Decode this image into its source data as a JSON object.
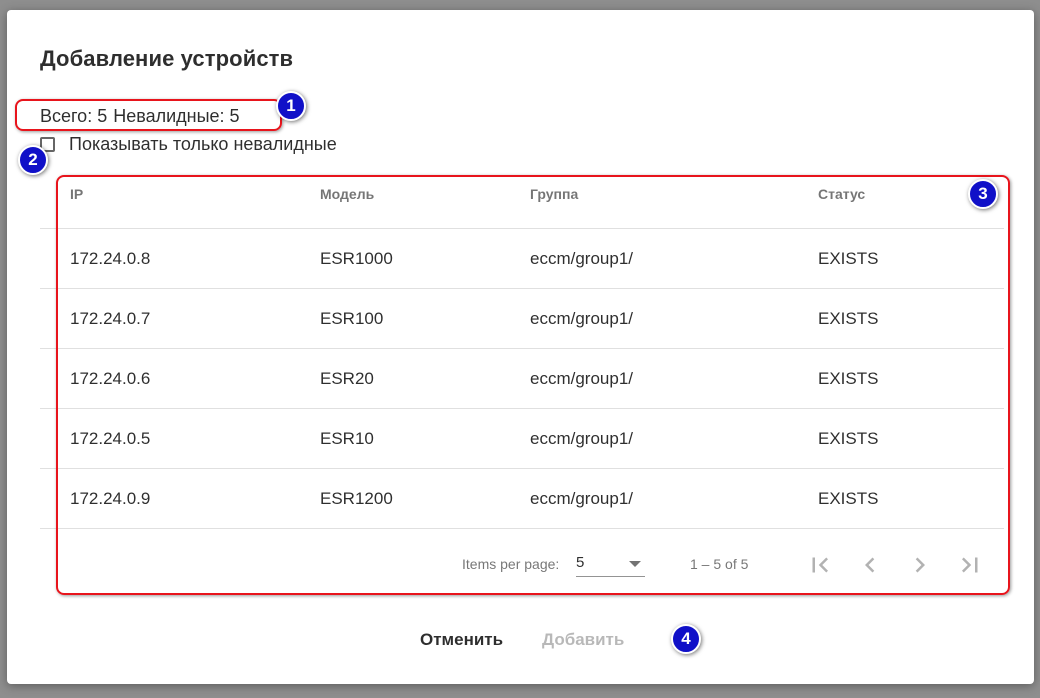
{
  "dialog": {
    "title": "Добавление устройств",
    "summary": {
      "total": "Всего: 5",
      "invalid": "Невалидные: 5"
    },
    "filter": {
      "label": "Показывать только невалидные",
      "checked": false
    },
    "table": {
      "columns": [
        "IP",
        "Модель",
        "Группа",
        "Статус"
      ],
      "rows": [
        {
          "ip": "172.24.0.8",
          "model": "ESR1000",
          "group": "eccm/group1/",
          "status": "EXISTS"
        },
        {
          "ip": "172.24.0.7",
          "model": "ESR100",
          "group": "eccm/group1/",
          "status": "EXISTS"
        },
        {
          "ip": "172.24.0.6",
          "model": "ESR20",
          "group": "eccm/group1/",
          "status": "EXISTS"
        },
        {
          "ip": "172.24.0.5",
          "model": "ESR10",
          "group": "eccm/group1/",
          "status": "EXISTS"
        },
        {
          "ip": "172.24.0.9",
          "model": "ESR1200",
          "group": "eccm/group1/",
          "status": "EXISTS"
        }
      ]
    },
    "paginator": {
      "items_per_page_label": "Items per page:",
      "items_per_page_value": "5",
      "range_label": "1 – 5 of 5",
      "icons": [
        "first-page-icon",
        "previous-page-icon",
        "next-page-icon",
        "last-page-icon"
      ]
    },
    "actions": {
      "cancel_label": "Отменить",
      "add_label": "Добавить"
    }
  },
  "annotations": {
    "badges": [
      "1",
      "2",
      "3",
      "4"
    ],
    "highlight_color": "#e8141c",
    "badge_color": "#1010c8"
  }
}
